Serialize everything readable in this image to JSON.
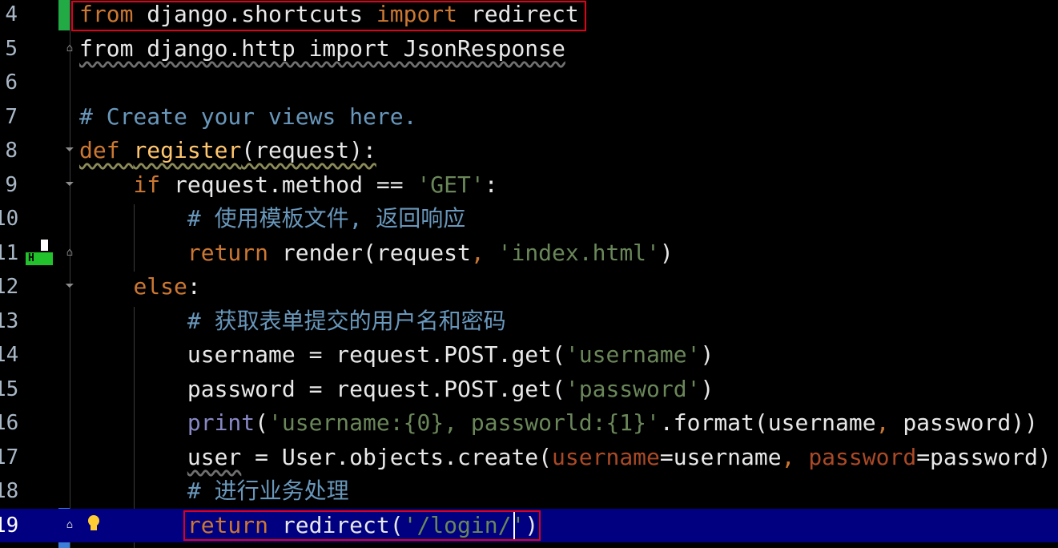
{
  "editor": {
    "current_line": "19",
    "lines": [
      {
        "num": "4",
        "segments": [
          {
            "text": "from",
            "cls": "kw"
          },
          {
            "text": " django.shortcuts ",
            "cls": "plain"
          },
          {
            "text": "import",
            "cls": "kw"
          },
          {
            "text": " redirect",
            "cls": "plain"
          }
        ]
      },
      {
        "num": "5",
        "segments": [
          {
            "text": "from django.http import JsonResponse",
            "cls": "plain squig-grey"
          }
        ]
      },
      {
        "num": "6",
        "segments": []
      },
      {
        "num": "7",
        "segments": [
          {
            "text": "# Create your views here.",
            "cls": "docc"
          }
        ]
      },
      {
        "num": "8",
        "segments": [
          {
            "text": "def ",
            "cls": "kw squig"
          },
          {
            "text": "register",
            "cls": "fn squig"
          },
          {
            "text": "(request):",
            "cls": "plain squig"
          }
        ]
      },
      {
        "num": "9",
        "segments": [
          {
            "text": "    ",
            "cls": "plain"
          },
          {
            "text": "if",
            "cls": "kw"
          },
          {
            "text": " request.method == ",
            "cls": "plain"
          },
          {
            "text": "'GET'",
            "cls": "str"
          },
          {
            "text": ":",
            "cls": "plain"
          }
        ]
      },
      {
        "num": "10",
        "segments": [
          {
            "text": "        ",
            "cls": "plain"
          },
          {
            "text": "# 使用模板文件, 返回响应",
            "cls": "docc"
          }
        ]
      },
      {
        "num": "11",
        "segments": [
          {
            "text": "        ",
            "cls": "plain"
          },
          {
            "text": "return",
            "cls": "kw"
          },
          {
            "text": " render(request",
            "cls": "plain"
          },
          {
            "text": ", ",
            "cls": "kw"
          },
          {
            "text": "'index.html'",
            "cls": "str"
          },
          {
            "text": ")",
            "cls": "plain"
          }
        ]
      },
      {
        "num": "12",
        "segments": [
          {
            "text": "    ",
            "cls": "plain"
          },
          {
            "text": "else",
            "cls": "kw"
          },
          {
            "text": ":",
            "cls": "plain"
          }
        ]
      },
      {
        "num": "13",
        "segments": [
          {
            "text": "        ",
            "cls": "plain"
          },
          {
            "text": "# 获取表单提交的用户名和密码",
            "cls": "docc"
          }
        ]
      },
      {
        "num": "14",
        "segments": [
          {
            "text": "        username = request.POST.get(",
            "cls": "plain"
          },
          {
            "text": "'username'",
            "cls": "str"
          },
          {
            "text": ")",
            "cls": "plain"
          }
        ]
      },
      {
        "num": "15",
        "segments": [
          {
            "text": "        password = request.POST.get(",
            "cls": "plain"
          },
          {
            "text": "'password'",
            "cls": "str"
          },
          {
            "text": ")",
            "cls": "plain"
          }
        ]
      },
      {
        "num": "16",
        "segments": [
          {
            "text": "        ",
            "cls": "plain"
          },
          {
            "text": "print",
            "cls": "bi"
          },
          {
            "text": "(",
            "cls": "plain"
          },
          {
            "text": "'username:{0}, passworld:{1}'",
            "cls": "str"
          },
          {
            "text": ".format(username",
            "cls": "plain"
          },
          {
            "text": ", ",
            "cls": "kw"
          },
          {
            "text": "password))",
            "cls": "plain"
          }
        ]
      },
      {
        "num": "17",
        "segments": [
          {
            "text": "        ",
            "cls": "plain"
          },
          {
            "text": "user",
            "cls": "plain squig-grey"
          },
          {
            "text": " = User.objects.create(",
            "cls": "plain"
          },
          {
            "text": "username",
            "cls": "param"
          },
          {
            "text": "=username",
            "cls": "plain"
          },
          {
            "text": ", ",
            "cls": "kw"
          },
          {
            "text": "password",
            "cls": "param"
          },
          {
            "text": "=password)",
            "cls": "plain"
          }
        ]
      },
      {
        "num": "18",
        "segments": [
          {
            "text": "        ",
            "cls": "plain"
          },
          {
            "text": "# 进行业务处理",
            "cls": "docc"
          }
        ]
      },
      {
        "num": "19",
        "segments": [
          {
            "text": "        ",
            "cls": "plain"
          },
          {
            "text": "return",
            "cls": "kw"
          },
          {
            "text": " redirect(",
            "cls": "plain"
          },
          {
            "text": "'/login/'",
            "cls": "str"
          },
          {
            "text": ")",
            "cls": "plain"
          }
        ]
      }
    ]
  },
  "gutter": {
    "vcs_marker_label": "H",
    "intention_icon": "lightbulb-icon",
    "fold_icon": "fold-marker-icon"
  },
  "colors": {
    "background": "#000000",
    "current_line": "#000080",
    "keyword": "#cc7832",
    "string": "#6a8759",
    "comment": "#6897bb",
    "function": "#ffc66d",
    "highlight_box": "#e0001a",
    "vcs_added": "#22aa44"
  }
}
